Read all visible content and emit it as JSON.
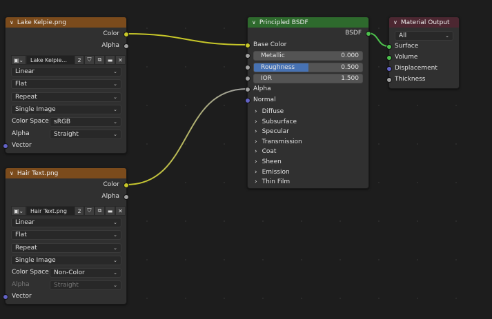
{
  "colors": {
    "image_header": "#7b4b1c",
    "bsdf_header": "#2e6a2d",
    "output_header": "#4c2731",
    "color_socket": "#c7c729",
    "float_socket": "#a1a1a1",
    "vector_socket": "#6363c7",
    "shader_socket": "#4dc14d",
    "slider_fill": "#4772b3"
  },
  "image_nodes": [
    {
      "title": "Lake Kelpie.png",
      "outputs": [
        "Color",
        "Alpha"
      ],
      "image_name": "Lake Kelpie...",
      "users": "2",
      "interpolation": "Linear",
      "projection": "Flat",
      "extension": "Repeat",
      "source": "Single Image",
      "color_space_label": "Color Space",
      "color_space": "sRGB",
      "alpha_label": "Alpha",
      "alpha": "Straight",
      "alpha_disabled": false,
      "input": "Vector"
    },
    {
      "title": "Hair Text.png",
      "outputs": [
        "Color",
        "Alpha"
      ],
      "image_name": "Hair Text.png",
      "users": "2",
      "interpolation": "Linear",
      "projection": "Flat",
      "extension": "Repeat",
      "source": "Single Image",
      "color_space_label": "Color Space",
      "color_space": "Non-Color",
      "alpha_label": "Alpha",
      "alpha": "Straight",
      "alpha_disabled": true,
      "input": "Vector"
    }
  ],
  "bsdf": {
    "title": "Principled BSDF",
    "output": "BSDF",
    "base_color": "Base Color",
    "sliders": [
      {
        "label": "Metallic",
        "value": "0.000",
        "fraction": 0
      },
      {
        "label": "Roughness",
        "value": "0.500",
        "fraction": 0.5
      },
      {
        "label": "IOR",
        "value": "1.500",
        "fraction": 0
      }
    ],
    "alpha": "Alpha",
    "normal": "Normal",
    "panels": [
      "Diffuse",
      "Subsurface",
      "Specular",
      "Transmission",
      "Coat",
      "Sheen",
      "Emission",
      "Thin Film"
    ]
  },
  "output": {
    "title": "Material Output",
    "target": "All",
    "inputs": [
      "Surface",
      "Volume",
      "Displacement",
      "Thickness"
    ]
  }
}
